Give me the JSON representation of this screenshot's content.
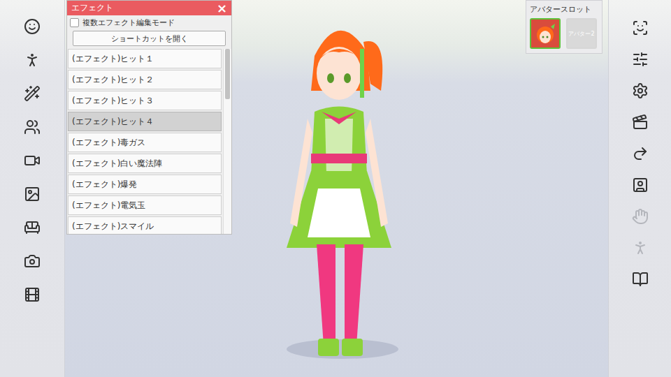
{
  "effect_panel": {
    "title": "エフェクト",
    "close": "×",
    "multi_edit": {
      "label": "複数エフェクト編集モード",
      "checked": false
    },
    "shortcut_button": "ショートカットを開く",
    "scrollbar": {
      "level": 0.27
    },
    "effects": [
      {
        "label": "(エフェクト)ヒット１",
        "selected": false
      },
      {
        "label": "(エフェクト)ヒット２",
        "selected": false
      },
      {
        "label": "(エフェクト)ヒット３",
        "selected": false
      },
      {
        "label": "(エフェクト)ヒット４",
        "selected": true
      },
      {
        "label": "(エフェクト)毒ガス",
        "selected": false
      },
      {
        "label": "(エフェクト)白い魔法陣",
        "selected": false
      },
      {
        "label": "(エフェクト)爆発",
        "selected": false
      },
      {
        "label": "(エフェクト)電気玉",
        "selected": false
      },
      {
        "label": "(エフェクト)スマイル",
        "selected": false
      }
    ]
  },
  "avatar_slot": {
    "title": "アバタースロット",
    "slots": [
      {
        "kind": "avatar",
        "label": "",
        "selected": true
      },
      {
        "kind": "empty",
        "label": "アバター2",
        "selected": false
      }
    ]
  },
  "left_toolbar": [
    {
      "disabled": false
    },
    {
      "disabled": false
    },
    {
      "disabled": false
    },
    {
      "disabled": false
    },
    {
      "disabled": false
    },
    {
      "disabled": false
    },
    {
      "disabled": false
    },
    {
      "disabled": false
    },
    {
      "disabled": false
    }
  ],
  "right_toolbar": [
    {
      "disabled": false
    },
    {
      "disabled": false
    },
    {
      "disabled": false
    },
    {
      "disabled": false
    },
    {
      "disabled": false
    },
    {
      "disabled": false
    },
    {
      "disabled": true
    },
    {
      "disabled": true
    },
    {
      "disabled": false
    }
  ]
}
